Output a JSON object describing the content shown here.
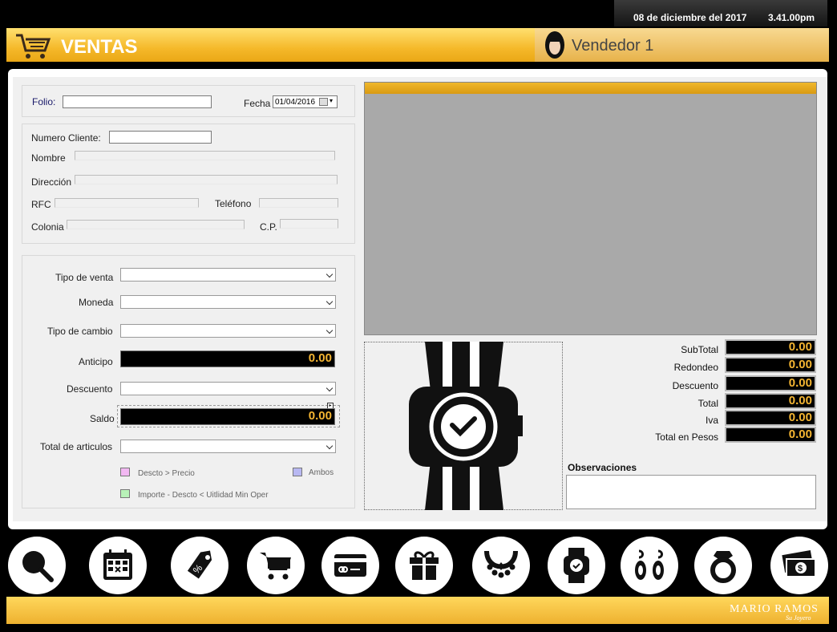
{
  "status": {
    "date": "08 de diciembre del 2017",
    "time": "3.41.00pm"
  },
  "header": {
    "title": "VENTAS",
    "seller": "Vendedor 1"
  },
  "invoice": {
    "folio_label": "Folio:",
    "folio_value": "",
    "date_label": "Fecha",
    "date_value": "01/04/2016"
  },
  "client": {
    "number_label": "Numero Cliente:",
    "name_label": "Nombre",
    "address_label": "Dirección",
    "rfc_label": "RFC",
    "phone_label": "Teléfono",
    "colony_label": "Colonia",
    "zip_label": "C.P."
  },
  "sale": {
    "type_label": "Tipo de venta",
    "currency_label": "Moneda",
    "exchange_label": "Tipo de cambio",
    "advance_label": "Anticipo",
    "advance_value": "0.00",
    "discount_label": "Descuento",
    "balance_label": "Saldo",
    "balance_value": "0.00",
    "items_label": "Total de articulos"
  },
  "legend": {
    "item1": "Descto > Precio",
    "item2": "Ambos",
    "item3": "Importe - Descto < Uitlidad Min Oper"
  },
  "colors": {
    "legend1": "#f2b8f2",
    "legend2": "#b8b8f2",
    "legend3": "#b8f2b8",
    "accent": "#f4b532"
  },
  "totals": [
    {
      "label": "SubTotal",
      "value": "0.00"
    },
    {
      "label": "Redondeo",
      "value": "0.00"
    },
    {
      "label": "Descuento",
      "value": "0.00"
    },
    {
      "label": "Total",
      "value": "0.00"
    },
    {
      "label": "Iva",
      "value": "0.00"
    },
    {
      "label": "Total en Pesos",
      "value": "0.00"
    }
  ],
  "observations": {
    "label": "Observaciones",
    "value": ""
  },
  "toolbar": {
    "icons": [
      "search-icon",
      "calendar-icon",
      "discount-tag-icon",
      "cart-icon",
      "credit-card-icon",
      "gift-icon",
      "necklace-icon",
      "watch-icon",
      "earrings-icon",
      "ring-icon",
      "money-icon"
    ]
  },
  "brand": {
    "name": "MARIO RAMOS",
    "tagline": "Su Joyero"
  }
}
